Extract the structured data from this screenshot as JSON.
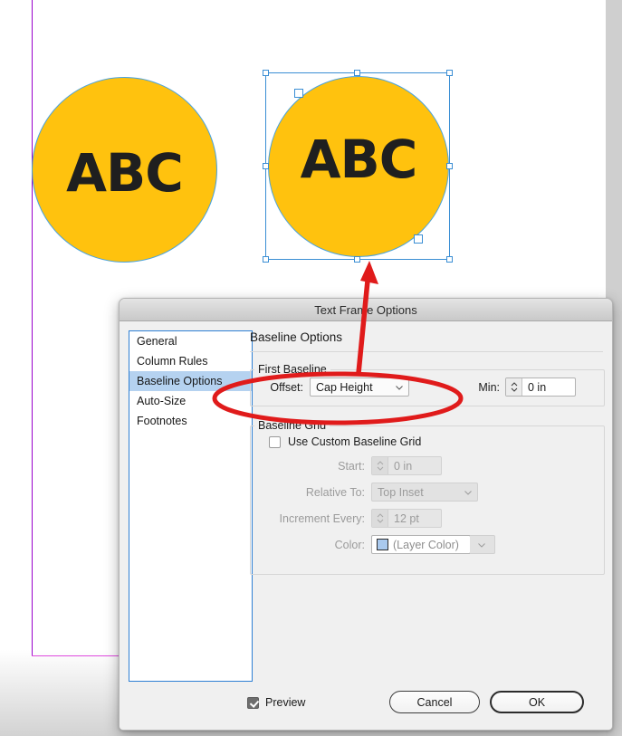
{
  "canvas": {
    "objects": [
      {
        "name": "circle-left",
        "text": "ABC",
        "fill": "#ffc20e",
        "stroke": "#4aa3df",
        "selected": false
      },
      {
        "name": "circle-right",
        "text": "ABC",
        "fill": "#ffc20e",
        "stroke": "#4aa3df",
        "selected": true
      }
    ],
    "guide_color": "#9900cc",
    "selection_color": "#3a8ed4",
    "annotation_color": "#e01b1b"
  },
  "dialog": {
    "title": "Text Frame Options",
    "panels": [
      {
        "label": "General",
        "selected": false
      },
      {
        "label": "Column Rules",
        "selected": false
      },
      {
        "label": "Baseline Options",
        "selected": true
      },
      {
        "label": "Auto-Size",
        "selected": false
      },
      {
        "label": "Footnotes",
        "selected": false
      }
    ],
    "section_heading": "Baseline Options",
    "first_baseline": {
      "legend": "First Baseline",
      "offset_label": "Offset:",
      "offset_value": "Cap Height",
      "min_label": "Min:",
      "min_value": "0 in"
    },
    "baseline_grid": {
      "legend": "Baseline Grid",
      "use_custom_label": "Use Custom Baseline Grid",
      "use_custom_checked": false,
      "start_label": "Start:",
      "start_value": "0 in",
      "relative_label": "Relative To:",
      "relative_value": "Top Inset",
      "increment_label": "Increment Every:",
      "increment_value": "12 pt",
      "color_label": "Color:",
      "color_value": "(Layer Color)",
      "color_swatch": "#a9c9ee"
    },
    "footer": {
      "preview_label": "Preview",
      "preview_checked": true,
      "cancel_label": "Cancel",
      "ok_label": "OK"
    }
  }
}
